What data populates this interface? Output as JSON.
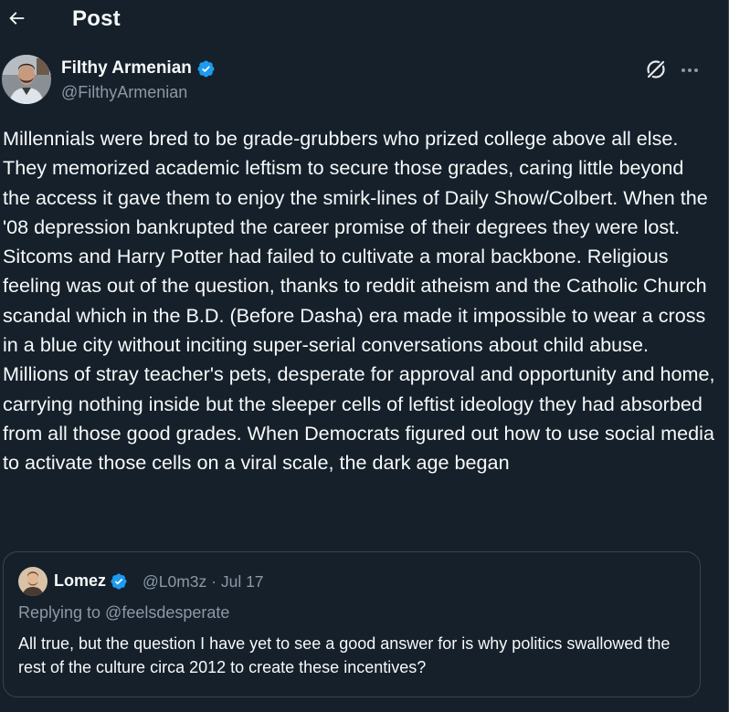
{
  "header": {
    "title": "Post"
  },
  "post": {
    "author_name": "Filthy Armenian",
    "author_handle": "@FilthyArmenian",
    "text": "Millennials were bred to be grade-grubbers who prized college above all else. They memorized academic leftism to secure those grades, caring little beyond the access it gave them to enjoy the smirk-lines of Daily Show/Colbert. When the '08 depression bankrupted the career promise of their degrees they were lost. Sitcoms and Harry Potter had failed to cultivate a moral backbone. Religious feeling was out of the question, thanks to reddit atheism and the Catholic Church scandal which in the B.D. (Before Dasha) era made it impossible to wear a cross in a blue city without inciting super-serial conversations about child abuse. Millions of stray teacher's pets, desperate for approval and opportunity and home, carrying nothing inside but the sleeper cells of leftist ideology they had absorbed from all those good grades. When Democrats figured out how to use social media to activate those cells on a viral scale, the dark age began"
  },
  "quote": {
    "author_name": "Lomez",
    "handle_date": "@L0m3z · Jul 17",
    "replying_to": "Replying to @feelsdesperate",
    "text": "All true, but the question I have yet to see a good answer for is why politics swallowed the rest of the culture circa 2012 to create these incentives?"
  },
  "icons": {
    "back": "arrow-left-icon",
    "verified": "verified-badge-icon",
    "grok": "grok-icon",
    "more": "more-dots-icon"
  },
  "colors": {
    "background": "#15202b",
    "text": "#f7f9f9",
    "secondary_text": "#8b98a5",
    "border": "#38444d",
    "verified": "#1d9bf0"
  }
}
